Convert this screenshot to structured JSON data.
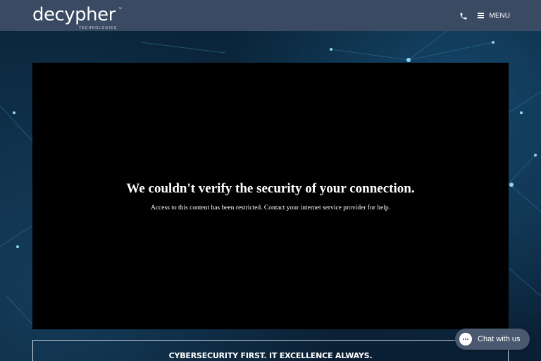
{
  "header": {
    "logo_text": "decypher",
    "logo_tm": "™",
    "logo_subtext": "TECHNOLOGIES",
    "phone_icon": "phone-icon",
    "menu_icon": "hamburger-menu-icon",
    "menu_label": "MENU"
  },
  "error_panel": {
    "title": "We couldn't verify the security of your connection.",
    "message": "Access to this content has been restricted. Contact your internet service provider for help."
  },
  "banner": {
    "text": "CYBERSECURITY FIRST. IT EXCELLENCE ALWAYS."
  },
  "chat": {
    "icon": "chat-bubble-icon",
    "label": "Chat with us"
  },
  "colors": {
    "header_bg": "#3a4a63",
    "page_bg": "#0b2236",
    "panel_bg": "#000000",
    "chat_bg": "#4a5870"
  }
}
